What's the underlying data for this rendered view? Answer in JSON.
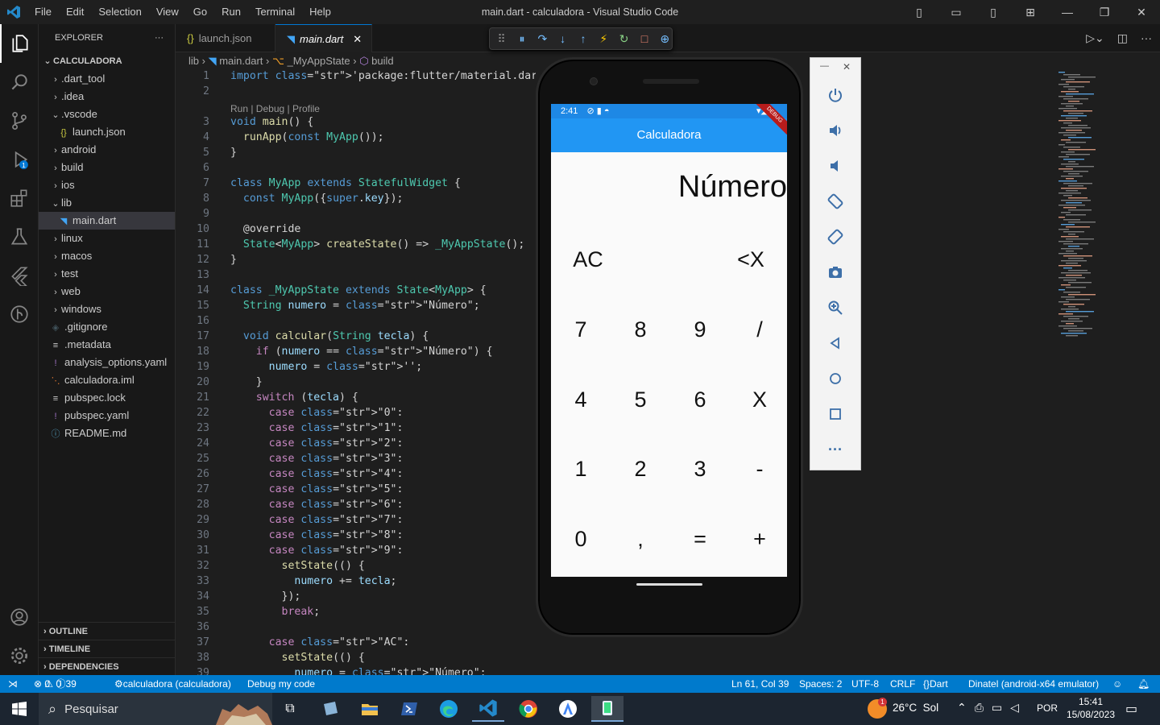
{
  "window": {
    "title": "main.dart - calculadora - Visual Studio Code",
    "menu": [
      "File",
      "Edit",
      "Selection",
      "View",
      "Go",
      "Run",
      "Terminal",
      "Help"
    ]
  },
  "explorer": {
    "title": "EXPLORER",
    "root": "CALCULADORA",
    "items": [
      {
        "label": ".dart_tool",
        "type": "folder"
      },
      {
        "label": ".idea",
        "type": "folder"
      },
      {
        "label": ".vscode",
        "type": "folder-open"
      },
      {
        "label": "launch.json",
        "type": "json"
      },
      {
        "label": "android",
        "type": "folder"
      },
      {
        "label": "build",
        "type": "folder"
      },
      {
        "label": "ios",
        "type": "folder"
      },
      {
        "label": "lib",
        "type": "folder-open"
      },
      {
        "label": "main.dart",
        "type": "dart"
      },
      {
        "label": "linux",
        "type": "folder"
      },
      {
        "label": "macos",
        "type": "folder"
      },
      {
        "label": "test",
        "type": "folder"
      },
      {
        "label": "web",
        "type": "folder"
      },
      {
        "label": "windows",
        "type": "folder"
      },
      {
        "label": ".gitignore",
        "type": "git"
      },
      {
        "label": ".metadata",
        "type": "lines"
      },
      {
        "label": "analysis_options.yaml",
        "type": "yaml"
      },
      {
        "label": "calculadora.iml",
        "type": "rss"
      },
      {
        "label": "pubspec.lock",
        "type": "lines"
      },
      {
        "label": "pubspec.yaml",
        "type": "yaml"
      },
      {
        "label": "README.md",
        "type": "info"
      }
    ],
    "sections": [
      "OUTLINE",
      "TIMELINE",
      "DEPENDENCIES"
    ]
  },
  "tabs": [
    {
      "label": "launch.json",
      "icon": "json-icon"
    },
    {
      "label": "main.dart",
      "icon": "dart-icon",
      "active": true
    }
  ],
  "breadcrumb": [
    "lib",
    "main.dart",
    "_MyAppState",
    "build"
  ],
  "codelens": "Run | Debug | Profile",
  "code_lines": [
    "import 'package:flutter/material.dart';",
    "",
    "void main() {",
    "  runApp(const MyApp());",
    "}",
    "",
    "class MyApp extends StatefulWidget {",
    "  const MyApp({super.key});",
    "",
    "  @override",
    "  State<MyApp> createState() => _MyAppState();",
    "}",
    "",
    "class _MyAppState extends State<MyApp> {",
    "  String numero = \"Número\";",
    "",
    "  void calcular(String tecla) {",
    "    if (numero == \"Número\") {",
    "      numero = '';",
    "    }",
    "    switch (tecla) {",
    "      case \"0\":",
    "      case \"1\":",
    "      case \"2\":",
    "      case \"3\":",
    "      case \"4\":",
    "      case \"5\":",
    "      case \"6\":",
    "      case \"7\":",
    "      case \"8\":",
    "      case \"9\":",
    "        setState(() {",
    "          numero += tecla;",
    "        });",
    "        break;",
    "",
    "      case \"AC\":",
    "        setState(() {",
    "          numero = \"Número\";"
  ],
  "statusbar": {
    "problems": "0",
    "warnings": "0",
    "info": "39",
    "debug_target": "calculadora (calculadora)",
    "debug_config": "Debug my code",
    "cursor": "Ln 61, Col 39",
    "spaces": "Spaces: 2",
    "encoding": "UTF-8",
    "eol": "CRLF",
    "language": "Dart",
    "device": "Dinatel (android-x64 emulator)"
  },
  "emulator": {
    "time": "2:41",
    "debug_ribbon": "DEBUG",
    "app_title": "Calculadora",
    "display": "Número",
    "keys": [
      [
        "AC",
        "<X"
      ],
      [
        "7",
        "8",
        "9",
        "/"
      ],
      [
        "4",
        "5",
        "6",
        "X"
      ],
      [
        "1",
        "2",
        "3",
        "-"
      ],
      [
        "0",
        ",",
        "=",
        "+"
      ]
    ]
  },
  "taskbar": {
    "search_placeholder": "Pesquisar",
    "weather": "26°C  Sol",
    "weather_badge": "1",
    "language": "POR",
    "time": "15:41",
    "date": "15/08/2023"
  },
  "colors": {
    "accent": "#007acc",
    "app_bar": "#2196f3"
  }
}
